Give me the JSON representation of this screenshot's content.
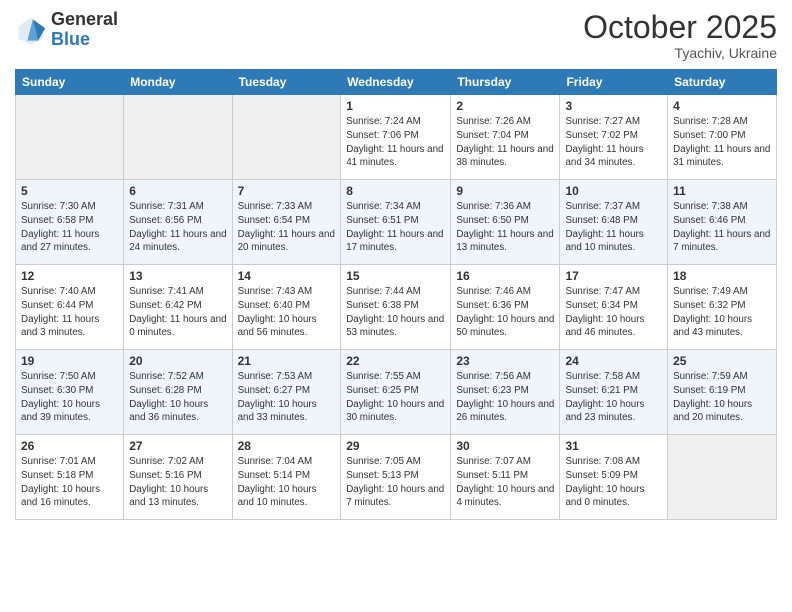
{
  "logo": {
    "general": "General",
    "blue": "Blue"
  },
  "header": {
    "month": "October 2025",
    "location": "Tyachiv, Ukraine"
  },
  "weekdays": [
    "Sunday",
    "Monday",
    "Tuesday",
    "Wednesday",
    "Thursday",
    "Friday",
    "Saturday"
  ],
  "weeks": [
    [
      {
        "day": "",
        "sunrise": "",
        "sunset": "",
        "daylight": ""
      },
      {
        "day": "",
        "sunrise": "",
        "sunset": "",
        "daylight": ""
      },
      {
        "day": "",
        "sunrise": "",
        "sunset": "",
        "daylight": ""
      },
      {
        "day": "1",
        "sunrise": "Sunrise: 7:24 AM",
        "sunset": "Sunset: 7:06 PM",
        "daylight": "Daylight: 11 hours and 41 minutes."
      },
      {
        "day": "2",
        "sunrise": "Sunrise: 7:26 AM",
        "sunset": "Sunset: 7:04 PM",
        "daylight": "Daylight: 11 hours and 38 minutes."
      },
      {
        "day": "3",
        "sunrise": "Sunrise: 7:27 AM",
        "sunset": "Sunset: 7:02 PM",
        "daylight": "Daylight: 11 hours and 34 minutes."
      },
      {
        "day": "4",
        "sunrise": "Sunrise: 7:28 AM",
        "sunset": "Sunset: 7:00 PM",
        "daylight": "Daylight: 11 hours and 31 minutes."
      }
    ],
    [
      {
        "day": "5",
        "sunrise": "Sunrise: 7:30 AM",
        "sunset": "Sunset: 6:58 PM",
        "daylight": "Daylight: 11 hours and 27 minutes."
      },
      {
        "day": "6",
        "sunrise": "Sunrise: 7:31 AM",
        "sunset": "Sunset: 6:56 PM",
        "daylight": "Daylight: 11 hours and 24 minutes."
      },
      {
        "day": "7",
        "sunrise": "Sunrise: 7:33 AM",
        "sunset": "Sunset: 6:54 PM",
        "daylight": "Daylight: 11 hours and 20 minutes."
      },
      {
        "day": "8",
        "sunrise": "Sunrise: 7:34 AM",
        "sunset": "Sunset: 6:51 PM",
        "daylight": "Daylight: 11 hours and 17 minutes."
      },
      {
        "day": "9",
        "sunrise": "Sunrise: 7:36 AM",
        "sunset": "Sunset: 6:50 PM",
        "daylight": "Daylight: 11 hours and 13 minutes."
      },
      {
        "day": "10",
        "sunrise": "Sunrise: 7:37 AM",
        "sunset": "Sunset: 6:48 PM",
        "daylight": "Daylight: 11 hours and 10 minutes."
      },
      {
        "day": "11",
        "sunrise": "Sunrise: 7:38 AM",
        "sunset": "Sunset: 6:46 PM",
        "daylight": "Daylight: 11 hours and 7 minutes."
      }
    ],
    [
      {
        "day": "12",
        "sunrise": "Sunrise: 7:40 AM",
        "sunset": "Sunset: 6:44 PM",
        "daylight": "Daylight: 11 hours and 3 minutes."
      },
      {
        "day": "13",
        "sunrise": "Sunrise: 7:41 AM",
        "sunset": "Sunset: 6:42 PM",
        "daylight": "Daylight: 11 hours and 0 minutes."
      },
      {
        "day": "14",
        "sunrise": "Sunrise: 7:43 AM",
        "sunset": "Sunset: 6:40 PM",
        "daylight": "Daylight: 10 hours and 56 minutes."
      },
      {
        "day": "15",
        "sunrise": "Sunrise: 7:44 AM",
        "sunset": "Sunset: 6:38 PM",
        "daylight": "Daylight: 10 hours and 53 minutes."
      },
      {
        "day": "16",
        "sunrise": "Sunrise: 7:46 AM",
        "sunset": "Sunset: 6:36 PM",
        "daylight": "Daylight: 10 hours and 50 minutes."
      },
      {
        "day": "17",
        "sunrise": "Sunrise: 7:47 AM",
        "sunset": "Sunset: 6:34 PM",
        "daylight": "Daylight: 10 hours and 46 minutes."
      },
      {
        "day": "18",
        "sunrise": "Sunrise: 7:49 AM",
        "sunset": "Sunset: 6:32 PM",
        "daylight": "Daylight: 10 hours and 43 minutes."
      }
    ],
    [
      {
        "day": "19",
        "sunrise": "Sunrise: 7:50 AM",
        "sunset": "Sunset: 6:30 PM",
        "daylight": "Daylight: 10 hours and 39 minutes."
      },
      {
        "day": "20",
        "sunrise": "Sunrise: 7:52 AM",
        "sunset": "Sunset: 6:28 PM",
        "daylight": "Daylight: 10 hours and 36 minutes."
      },
      {
        "day": "21",
        "sunrise": "Sunrise: 7:53 AM",
        "sunset": "Sunset: 6:27 PM",
        "daylight": "Daylight: 10 hours and 33 minutes."
      },
      {
        "day": "22",
        "sunrise": "Sunrise: 7:55 AM",
        "sunset": "Sunset: 6:25 PM",
        "daylight": "Daylight: 10 hours and 30 minutes."
      },
      {
        "day": "23",
        "sunrise": "Sunrise: 7:56 AM",
        "sunset": "Sunset: 6:23 PM",
        "daylight": "Daylight: 10 hours and 26 minutes."
      },
      {
        "day": "24",
        "sunrise": "Sunrise: 7:58 AM",
        "sunset": "Sunset: 6:21 PM",
        "daylight": "Daylight: 10 hours and 23 minutes."
      },
      {
        "day": "25",
        "sunrise": "Sunrise: 7:59 AM",
        "sunset": "Sunset: 6:19 PM",
        "daylight": "Daylight: 10 hours and 20 minutes."
      }
    ],
    [
      {
        "day": "26",
        "sunrise": "Sunrise: 7:01 AM",
        "sunset": "Sunset: 5:18 PM",
        "daylight": "Daylight: 10 hours and 16 minutes."
      },
      {
        "day": "27",
        "sunrise": "Sunrise: 7:02 AM",
        "sunset": "Sunset: 5:16 PM",
        "daylight": "Daylight: 10 hours and 13 minutes."
      },
      {
        "day": "28",
        "sunrise": "Sunrise: 7:04 AM",
        "sunset": "Sunset: 5:14 PM",
        "daylight": "Daylight: 10 hours and 10 minutes."
      },
      {
        "day": "29",
        "sunrise": "Sunrise: 7:05 AM",
        "sunset": "Sunset: 5:13 PM",
        "daylight": "Daylight: 10 hours and 7 minutes."
      },
      {
        "day": "30",
        "sunrise": "Sunrise: 7:07 AM",
        "sunset": "Sunset: 5:11 PM",
        "daylight": "Daylight: 10 hours and 4 minutes."
      },
      {
        "day": "31",
        "sunrise": "Sunrise: 7:08 AM",
        "sunset": "Sunset: 5:09 PM",
        "daylight": "Daylight: 10 hours and 0 minutes."
      },
      {
        "day": "",
        "sunrise": "",
        "sunset": "",
        "daylight": ""
      }
    ]
  ]
}
